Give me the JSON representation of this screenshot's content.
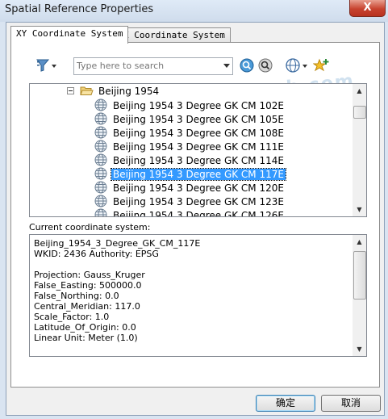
{
  "window": {
    "title": "Spatial Reference Properties",
    "close_glyph": "X"
  },
  "tabs": [
    {
      "label": "XY Coordinate System",
      "active": true
    },
    {
      "label": "Z Coordinate System",
      "active": false
    }
  ],
  "toolbar": {
    "filter_icon": "filter-icon",
    "search_placeholder": "Type here to search",
    "search_value": "",
    "search_icons": [
      "search-icon",
      "search-options-icon"
    ],
    "globe_icon": "globe-icon",
    "add_icon": "add-coordinate-system-icon"
  },
  "watermark": "草根网 ccob.com",
  "tree": {
    "folder": {
      "label": "Beijing 1954",
      "expanded": true
    },
    "items": [
      {
        "label": "Beijing 1954 3 Degree GK CM 102E",
        "selected": false
      },
      {
        "label": "Beijing 1954 3 Degree GK CM 105E",
        "selected": false
      },
      {
        "label": "Beijing 1954 3 Degree GK CM 108E",
        "selected": false
      },
      {
        "label": "Beijing 1954 3 Degree GK CM 111E",
        "selected": false
      },
      {
        "label": "Beijing 1954 3 Degree GK CM 114E",
        "selected": false
      },
      {
        "label": "Beijing 1954 3 Degree GK CM 117E",
        "selected": true
      },
      {
        "label": "Beijing 1954 3 Degree GK CM 120E",
        "selected": false
      },
      {
        "label": "Beijing 1954 3 Degree GK CM 123E",
        "selected": false
      },
      {
        "label": "Beijing 1954 3 Degree GK CM 126E",
        "selected": false
      }
    ]
  },
  "current": {
    "label": "Current coordinate system:",
    "lines": [
      "Beijing_1954_3_Degree_GK_CM_117E",
      "WKID: 2436 Authority: EPSG",
      "",
      "Projection: Gauss_Kruger",
      "False_Easting: 500000.0",
      "False_Northing: 0.0",
      "Central_Meridian: 117.0",
      "Scale_Factor: 1.0",
      "Latitude_Of_Origin: 0.0",
      "Linear Unit: Meter (1.0)"
    ]
  },
  "buttons": {
    "ok": "确定",
    "cancel": "取消"
  },
  "colors": {
    "selection": "#3399ff",
    "titlebar": "#cfdcec",
    "close": "#c7432f"
  }
}
